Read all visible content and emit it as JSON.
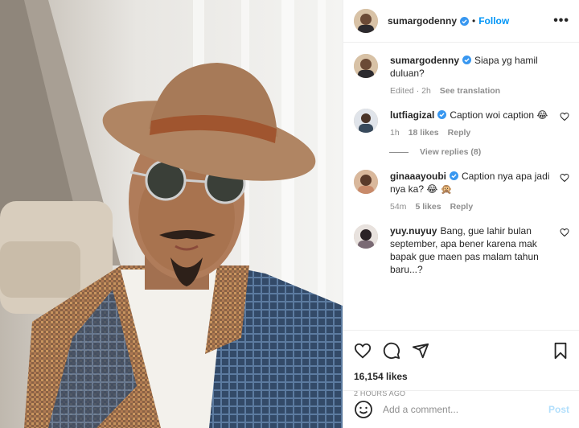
{
  "header": {
    "username": "sumargodenny",
    "dot": "•",
    "follow_label": "Follow",
    "more_label": "•••"
  },
  "caption": {
    "username": "sumargodenny",
    "text": "Siapa yg hamil duluan?",
    "edited": "Edited · 2h",
    "see_translation": "See translation"
  },
  "comments": [
    {
      "username": "lutfiagizal",
      "text": "Caption woi caption 😂",
      "time": "1h",
      "likes": "18 likes",
      "reply": "Reply",
      "view_replies": "View replies (8)"
    },
    {
      "username": "ginaaayoubi",
      "text": "Caption nya apa jadi nya ka? 😂 🙊",
      "time": "54m",
      "likes": "5 likes",
      "reply": "Reply"
    },
    {
      "username": "yuy.nuyuy",
      "text": "Bang, gue lahir bulan september, apa bener karena mak bapak gue maen pas malam tahun baru...?"
    }
  ],
  "actions": {
    "likes": "16,154 likes",
    "time": "2 HOURS AGO"
  },
  "add_comment": {
    "placeholder": "Add a comment...",
    "post_label": "Post"
  },
  "colors": {
    "accent": "#0095f6",
    "post_disabled": "#b2dffc",
    "muted": "#8e8e8e",
    "text": "#262626",
    "verified": "#3897f0"
  }
}
